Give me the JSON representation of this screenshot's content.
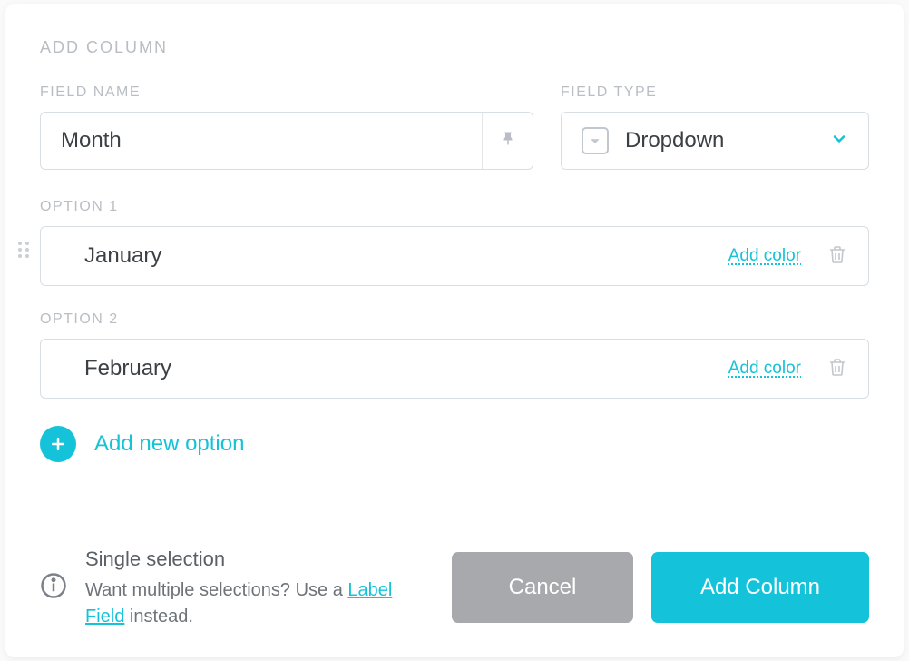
{
  "modal": {
    "title": "ADD COLUMN",
    "fieldNameLabel": "FIELD NAME",
    "fieldNameValue": "Month",
    "fieldTypeLabel": "FIELD TYPE",
    "fieldTypeValue": "Dropdown"
  },
  "options": [
    {
      "label": "OPTION 1",
      "value": "January",
      "addColor": "Add color",
      "hasDrag": true
    },
    {
      "label": "OPTION 2",
      "value": "February",
      "addColor": "Add color",
      "hasDrag": false
    }
  ],
  "addNewOption": "Add new option",
  "info": {
    "title": "Single selection",
    "prefix": "Want multiple selections? Use a ",
    "link": "Label Field",
    "suffix": " instead."
  },
  "buttons": {
    "cancel": "Cancel",
    "confirm": "Add Column"
  }
}
